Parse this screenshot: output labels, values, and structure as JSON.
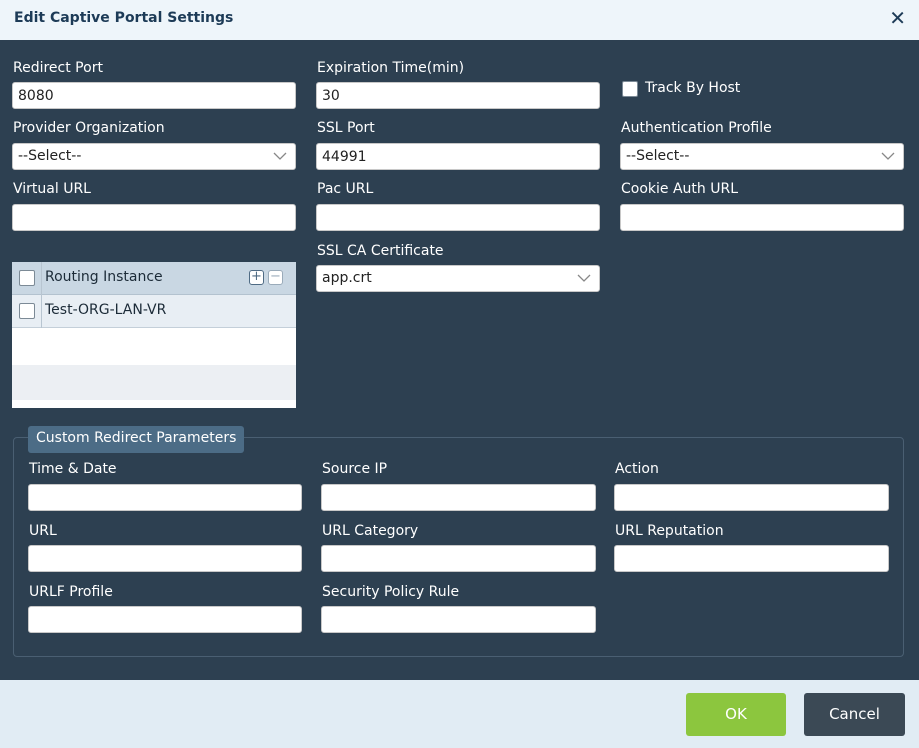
{
  "dialog": {
    "title": "Edit Captive Portal Settings",
    "close_glyph": "✕"
  },
  "fields": {
    "redirect_port": {
      "label": "Redirect Port",
      "value": "8080"
    },
    "expiration_time": {
      "label": "Expiration Time(min)",
      "value": "30"
    },
    "track_by_host": {
      "label": "Track By Host",
      "checked": false
    },
    "provider_organization": {
      "label": "Provider Organization",
      "selected": "--Select--"
    },
    "ssl_port": {
      "label": "SSL Port",
      "value": "44991"
    },
    "authentication_profile": {
      "label": "Authentication Profile",
      "selected": "--Select--"
    },
    "virtual_url": {
      "label": "Virtual URL",
      "value": ""
    },
    "pac_url": {
      "label": "Pac URL",
      "value": ""
    },
    "cookie_auth_url": {
      "label": "Cookie Auth URL",
      "value": ""
    },
    "ssl_ca_certificate": {
      "label": "SSL CA Certificate",
      "selected": "app.crt"
    }
  },
  "routing_table": {
    "header": "Routing Instance",
    "add_icon": "plus-icon",
    "remove_icon": "minus-icon",
    "rows": [
      {
        "name": "Test-ORG-LAN-VR",
        "checked": false
      }
    ]
  },
  "custom_redirect": {
    "legend": "Custom Redirect Parameters",
    "time_date": {
      "label": "Time & Date",
      "value": ""
    },
    "source_ip": {
      "label": "Source IP",
      "value": ""
    },
    "action": {
      "label": "Action",
      "value": ""
    },
    "url": {
      "label": "URL",
      "value": ""
    },
    "url_category": {
      "label": "URL Category",
      "value": ""
    },
    "url_reputation": {
      "label": "URL Reputation",
      "value": ""
    },
    "urlf_profile": {
      "label": "URLF Profile",
      "value": ""
    },
    "security_policy_rule": {
      "label": "Security Policy Rule",
      "value": ""
    }
  },
  "footer": {
    "ok_label": "OK",
    "cancel_label": "Cancel"
  },
  "colors": {
    "body_bg": "#2d4051",
    "title_bar_bg": "#eef5fa",
    "ok_button": "#8cc63e",
    "cancel_button": "#3b4955",
    "legend_bg": "#4c6c86"
  }
}
